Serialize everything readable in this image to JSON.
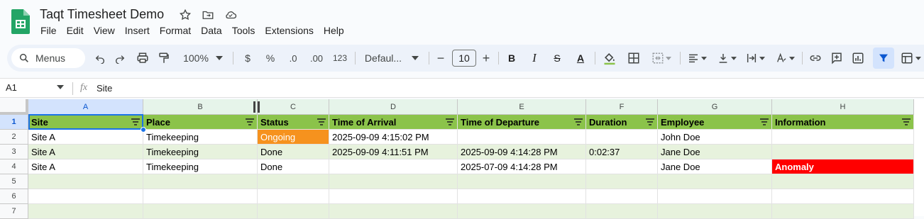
{
  "app": {
    "title": "Taqt Timesheet Demo",
    "menu": [
      "File",
      "Edit",
      "View",
      "Insert",
      "Format",
      "Data",
      "Tools",
      "Extensions",
      "Help"
    ]
  },
  "toolbar": {
    "menus_label": "Menus",
    "zoom": "100%",
    "currency": "$",
    "percent": "%",
    "decrease_decimal": ".0",
    "increase_decimal": ".00",
    "number_format": "123",
    "font": "Defaul...",
    "font_size": "10",
    "minus": "−",
    "plus": "+",
    "bold": "B",
    "italic": "I",
    "strike": "S",
    "text_color": "A"
  },
  "formula_bar": {
    "cell_ref": "A1",
    "fx": "fx",
    "value": "Site"
  },
  "sheet": {
    "columns": [
      "A",
      "B",
      "C",
      "D",
      "E",
      "F",
      "G",
      "H"
    ],
    "rows": [
      "1",
      "2",
      "3",
      "4",
      "5",
      "6",
      "7"
    ],
    "header": [
      "Site",
      "Place",
      "Status",
      "Time of Arrival",
      "Time of Departure",
      "Duration",
      "Employee",
      "Information"
    ],
    "data": [
      [
        "Site A",
        "Timekeeping",
        "Ongoing",
        "2025-09-09 4:15:02 PM",
        "",
        "",
        "John Doe",
        ""
      ],
      [
        "Site A",
        "Timekeeping",
        "Done",
        "2025-09-09 4:11:51 PM",
        "2025-09-09 4:14:28 PM",
        "0:02:37",
        "Jane Doe",
        ""
      ],
      [
        "Site A",
        "Timekeeping",
        "Done",
        "",
        "2025-07-09 4:14:28 PM",
        "",
        "Jane Doe",
        "Anomaly"
      ],
      [
        "",
        "",
        "",
        "",
        "",
        "",
        "",
        ""
      ],
      [
        "",
        "",
        "",
        "",
        "",
        "",
        "",
        ""
      ],
      [
        "",
        "",
        "",
        "",
        "",
        "",
        "",
        ""
      ]
    ]
  },
  "colors": {
    "header_green": "#8bc34a",
    "band_green": "#e7f2dd",
    "ongoing_orange": "#f6921e",
    "anomaly_red": "#ff0000",
    "selection_blue": "#1a73e8"
  }
}
